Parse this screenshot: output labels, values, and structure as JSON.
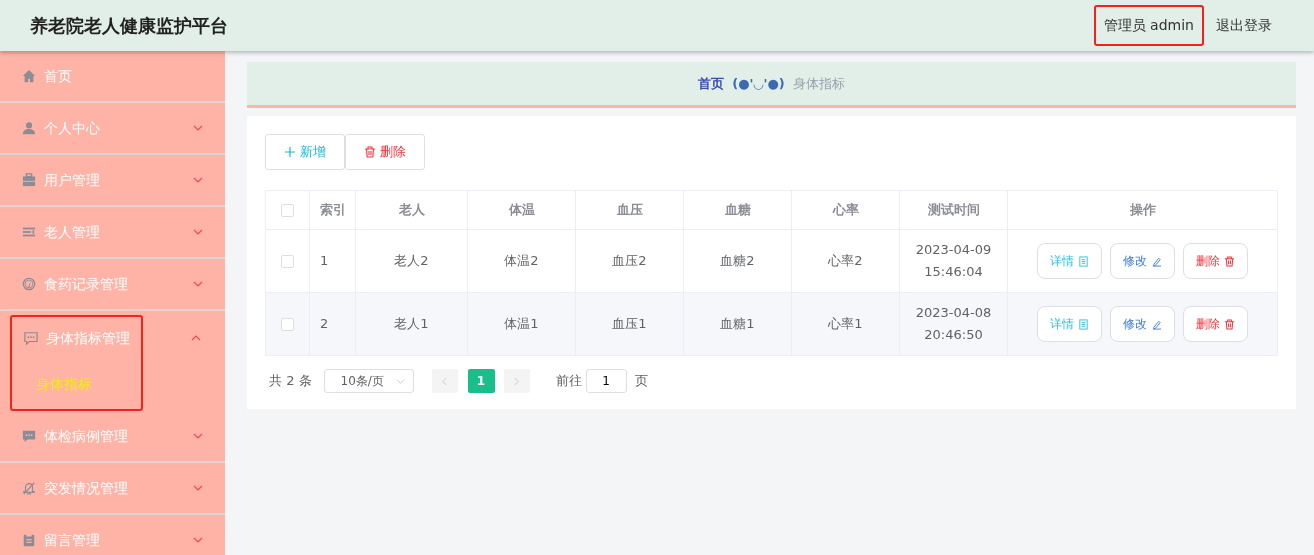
{
  "header": {
    "title": "养老院老人健康监护平台",
    "user": {
      "label": "管理员 admin",
      "highlighted": true
    },
    "logout": "退出登录"
  },
  "sidebar": {
    "items": [
      {
        "label": "首页",
        "kind": "link",
        "expanded": false,
        "highlighted": false
      },
      {
        "label": "个人中心",
        "kind": "group",
        "expanded": false,
        "highlighted": false
      },
      {
        "label": "用户管理",
        "kind": "group",
        "expanded": false,
        "highlighted": false
      },
      {
        "label": "老人管理",
        "kind": "group",
        "expanded": false,
        "highlighted": false
      },
      {
        "label": "食药记录管理",
        "kind": "group",
        "expanded": false,
        "highlighted": false
      },
      {
        "label": "身体指标管理",
        "kind": "group",
        "expanded": true,
        "highlighted": true,
        "children": [
          {
            "label": "身体指标",
            "selected": true
          }
        ]
      },
      {
        "label": "体检病例管理",
        "kind": "group",
        "expanded": false,
        "highlighted": false
      },
      {
        "label": "突发情况管理",
        "kind": "group",
        "expanded": false,
        "highlighted": false
      },
      {
        "label": "留言管理",
        "kind": "group",
        "expanded": false,
        "highlighted": false
      }
    ]
  },
  "breadcrumb": [
    "首页",
    "(●'◡'●)",
    "身体指标"
  ],
  "toolbar": [
    {
      "label": "新增",
      "kind": "add"
    },
    {
      "label": "删除",
      "kind": "delete"
    }
  ],
  "table": {
    "select_all_checked": false,
    "columns": [
      "索引",
      "老人",
      "体温",
      "血压",
      "血糖",
      "心率",
      "测试时间",
      "操作"
    ],
    "rows": [
      {
        "checked": false,
        "cells": [
          "1",
          "老人2",
          "体温2",
          "血压2",
          "血糖2",
          "心率2",
          "2023-04-09 15:46:04"
        ],
        "actions": [
          {
            "label": "详情",
            "kind": "detail"
          },
          {
            "label": "修改",
            "kind": "edit"
          },
          {
            "label": "删除",
            "kind": "delete"
          }
        ]
      },
      {
        "checked": false,
        "cells": [
          "2",
          "老人1",
          "体温1",
          "血压1",
          "血糖1",
          "心率1",
          "2023-04-08 20:46:50"
        ],
        "actions": [
          {
            "label": "详情",
            "kind": "detail"
          },
          {
            "label": "修改",
            "kind": "edit"
          },
          {
            "label": "删除",
            "kind": "delete"
          }
        ]
      }
    ]
  },
  "pagination": {
    "total": "共 2 条",
    "page_size": "10条/页",
    "pages": [
      {
        "label": "1",
        "selected": true
      }
    ],
    "goto_label": "前往",
    "goto_value": "1",
    "goto_suffix": "页"
  }
}
